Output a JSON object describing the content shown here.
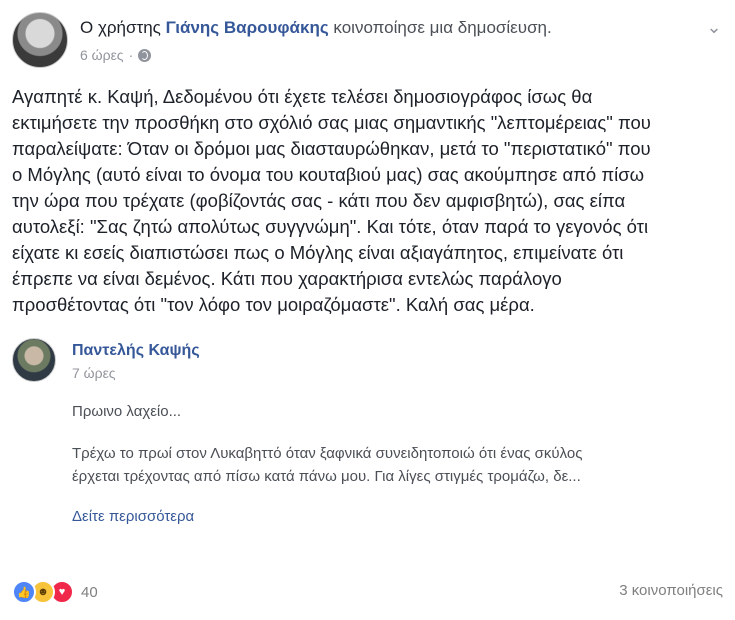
{
  "header": {
    "prefix": "Ο χρήστης",
    "author": "Γιάνης Βαρουφάκης",
    "action": "κοινοποίησε μια δημοσίευση.",
    "time": "6 ώρες",
    "separator": "·",
    "privacy_icon": "globe-icon",
    "menu_icon": "chevron-down-icon"
  },
  "post": {
    "text": "Αγαπητέ κ. Καψή, Δεδομένου ότι έχετε τελέσει δημοσιογράφος ίσως θα\nεκτιμήσετε την προσθήκη στο σχόλιό σας μιας σημαντικής \"λεπτομέρειας\" που\nπαραλείψατε: Όταν οι δρόμοι μας διασταυρώθηκαν, μετά το \"περιστατικό\" που\nο Μόγλης (αυτό είναι το όνομα του κουταβιού μας) σας ακούμπησε από πίσω\nτην ώρα που τρέχατε (φοβίζοντάς σας - κάτι που δεν αμφισβητώ), σας είπα\nαυτολεξί: \"Σας ζητώ απολύτως συγγνώμη\". Και τότε, όταν παρά το γεγονός ότι\nείχατε κι εσείς διαπιστώσει πως ο Μόγλης είναι αξιαγάπητος, επιμείνατε ότι\nέπρεπε να είναι δεμένος. Κάτι που χαρακτήρισα εντελώς παράλογο\nπροσθέτοντας ότι \"τον λόφο τον μοιραζόμαστε\". Καλή σας μέρα."
  },
  "shared": {
    "author": "Παντελής Καψής",
    "time": "7 ώρες",
    "title": "Πρωινο λαχείο...",
    "body": "Τρέχω το πρωί στον Λυκαβηττό όταν ξαφνικά συνειδητοποιώ ότι ένας σκύλος\nέρχεται τρέχοντας από πίσω κατά πάνω μου. Για λίγες στιγμές τρομάζω, δε...",
    "see_more": "Δείτε περισσότερα"
  },
  "footer": {
    "reaction_icons": [
      "like-icon",
      "haha-icon",
      "love-icon"
    ],
    "reaction_count": "40",
    "shares": "3 κοινοποιήσεις"
  },
  "colors": {
    "link": "#365899",
    "meta": "#90949c",
    "text": "#1d2129",
    "like": "#4f86f7",
    "haha": "#f7c33a",
    "love": "#f0284a"
  }
}
